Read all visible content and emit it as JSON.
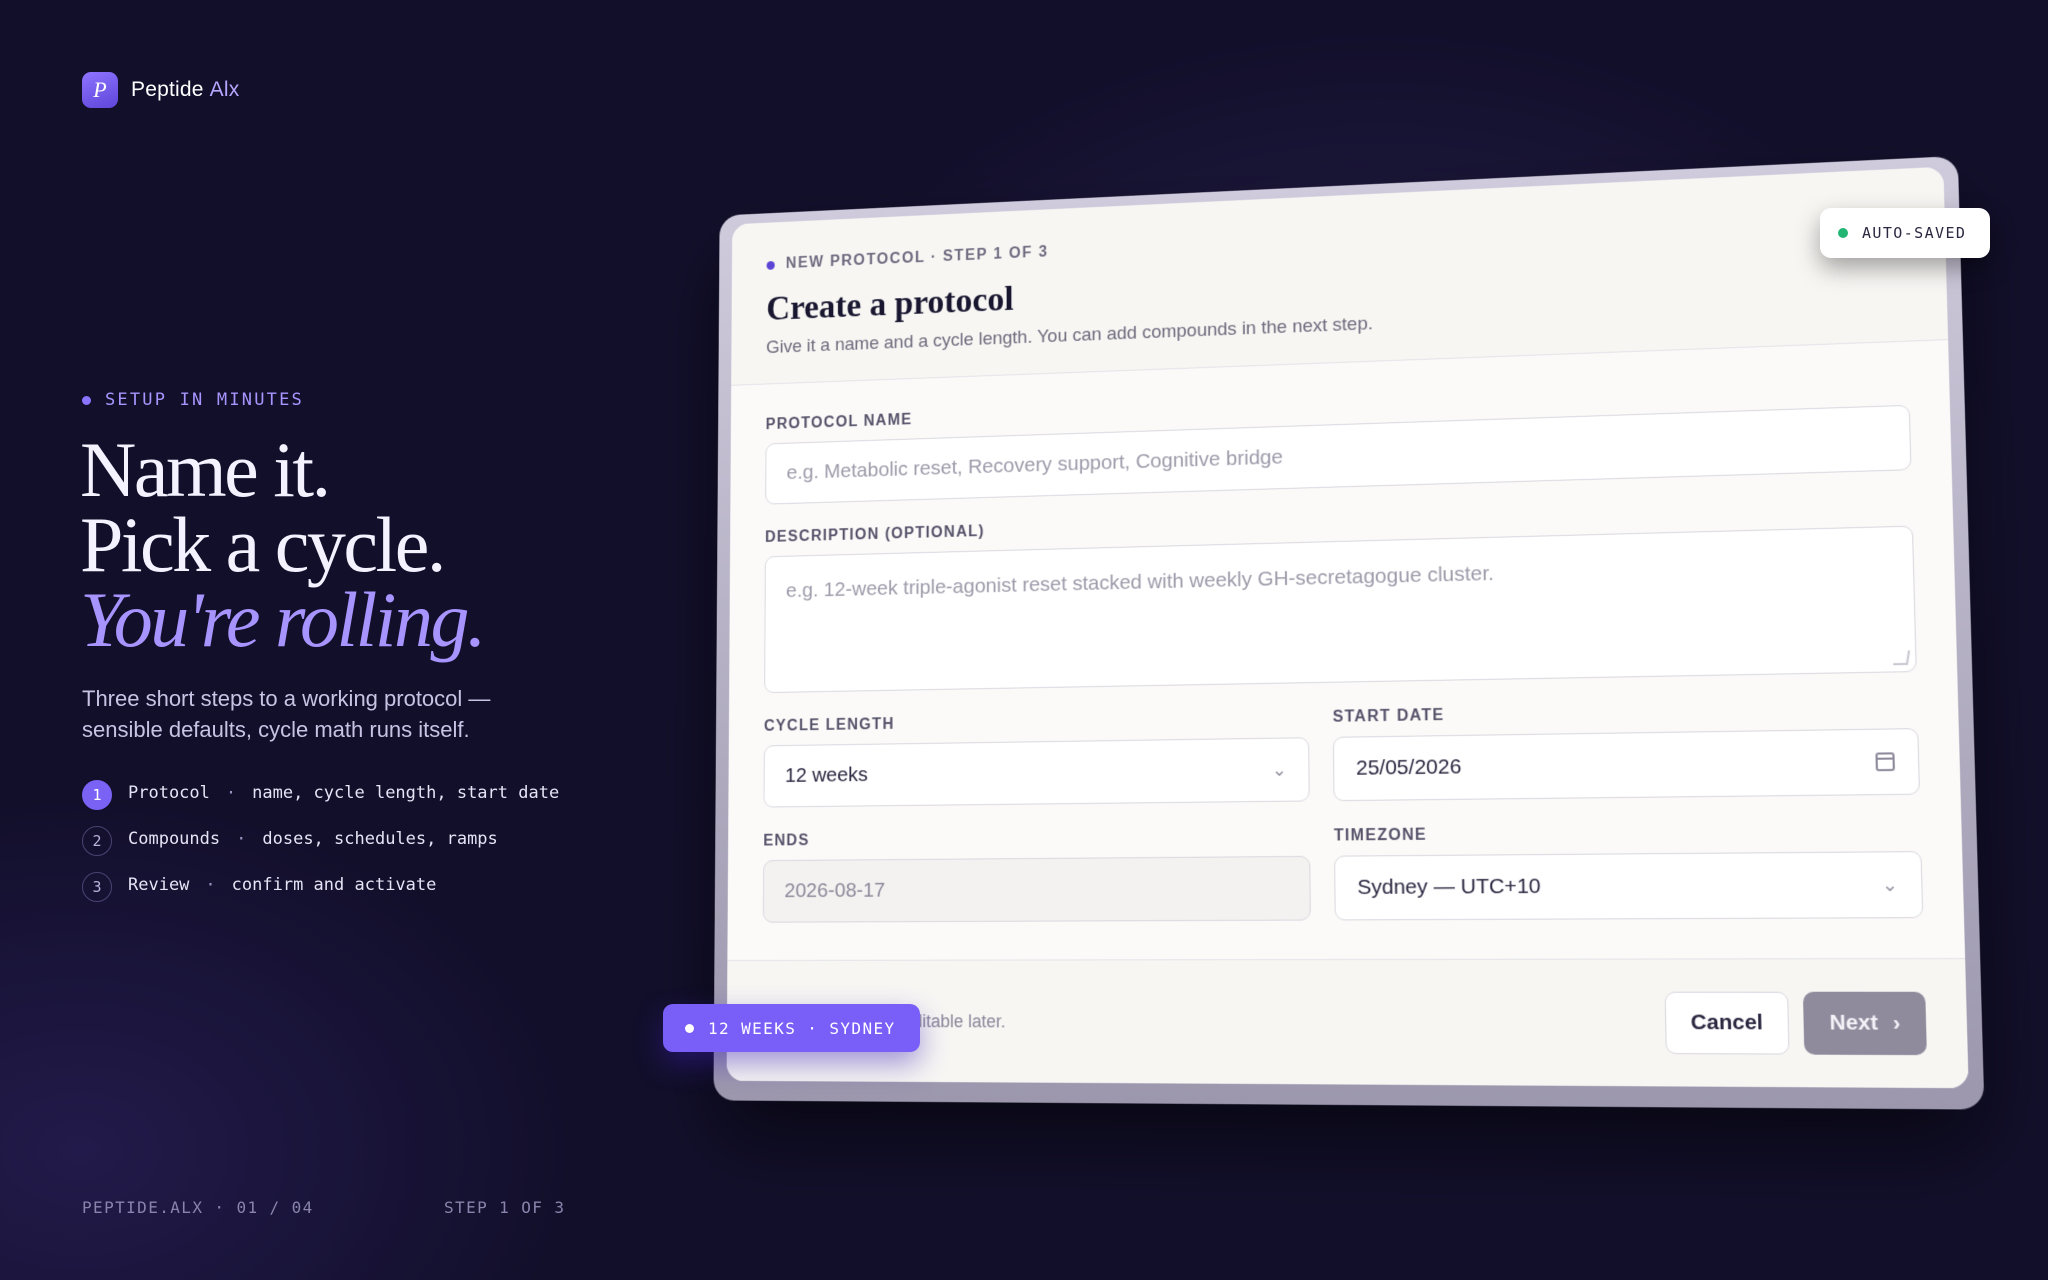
{
  "brand": {
    "logo_letter": "P",
    "name": "Peptide",
    "accent": "Alx"
  },
  "hero": {
    "eyebrow": "SETUP IN MINUTES",
    "headline": [
      "Name it.",
      "Pick a cycle.",
      "You're rolling."
    ],
    "lede": [
      "Three short steps to a working protocol —",
      "sensible defaults, cycle math runs itself."
    ]
  },
  "steps": [
    {
      "num": "1",
      "title": "Protocol",
      "detail": "name, cycle length, start date",
      "active": true
    },
    {
      "num": "2",
      "title": "Compounds",
      "detail": "doses, schedules, ramps",
      "active": false
    },
    {
      "num": "3",
      "title": "Review",
      "detail": "confirm and activate",
      "active": false
    }
  ],
  "footer": {
    "left": "PEPTIDE.ALX · 01 / 04",
    "step": "STEP 1 OF 3"
  },
  "card": {
    "kicker": "NEW PROTOCOL · STEP 1 OF 3",
    "title": "Create a protocol",
    "subtitle": "Give it a name and a cycle length. You can add compounds in the next step.",
    "fields": {
      "name": {
        "label": "PROTOCOL NAME",
        "placeholder": "e.g. Metabolic reset, Recovery support, Cognitive bridge",
        "value": ""
      },
      "description": {
        "label": "DESCRIPTION (OPTIONAL)",
        "placeholder": "e.g. 12-week triple-agonist reset stacked with weekly GH-secretagogue cluster.",
        "value": ""
      },
      "cycle_length": {
        "label": "CYCLE LENGTH",
        "value": "12 weeks"
      },
      "start_date": {
        "label": "START DATE",
        "value": "25/05/2026"
      },
      "ends": {
        "label": "ENDS",
        "value": "2026-08-17"
      },
      "timezone": {
        "label": "TIMEZONE",
        "value": "Sydney — UTC+10"
      }
    },
    "foot_note": "editable later.",
    "cancel_label": "Cancel",
    "next_label": "Next"
  },
  "badges": {
    "autosaved": "AUTO-SAVED",
    "pill": "12 WEEKS · SYDNEY"
  },
  "colors": {
    "accent": "#7a5ef8",
    "accent_light": "#a894ff",
    "background": "#120f2b",
    "saved_green": "#22b573"
  }
}
